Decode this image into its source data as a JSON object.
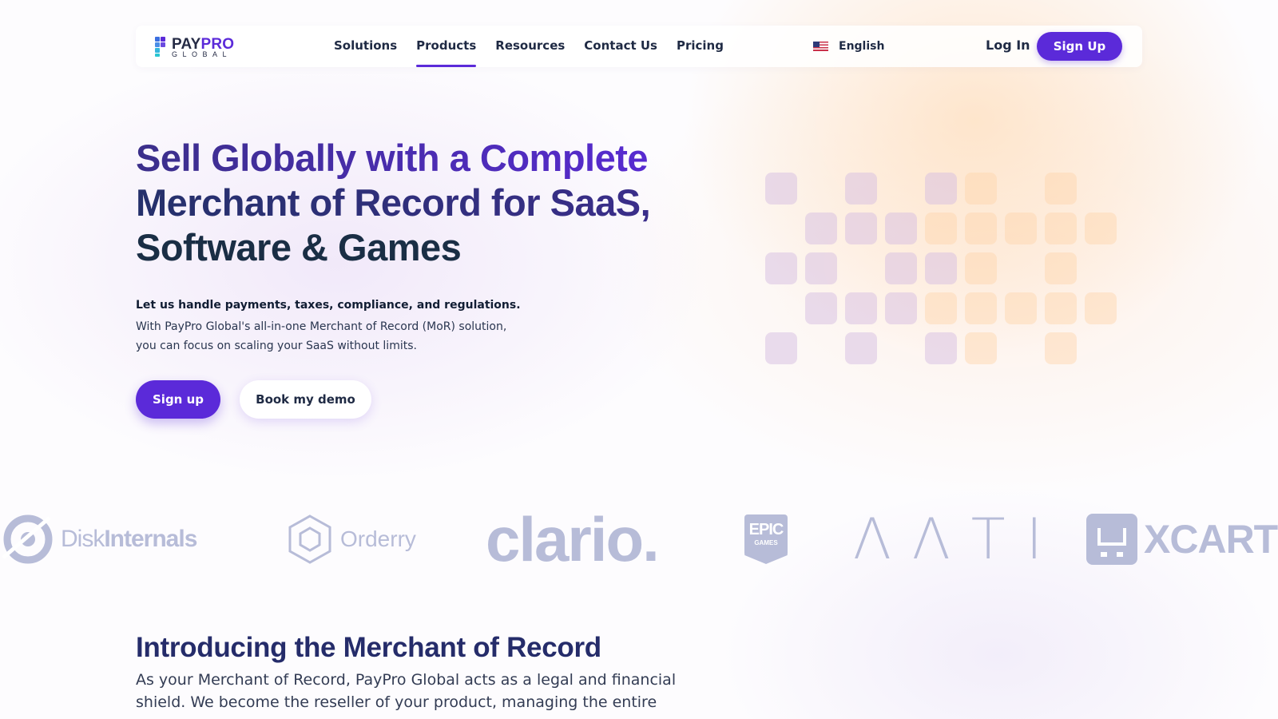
{
  "nav": {
    "logo_main_1": "PAY",
    "logo_main_2": "PRO",
    "logo_sub": "GLOBAL",
    "items": [
      {
        "label": "Solutions",
        "active": false
      },
      {
        "label": "Products",
        "active": true
      },
      {
        "label": "Resources",
        "active": false
      },
      {
        "label": "Contact Us",
        "active": false
      },
      {
        "label": "Pricing",
        "active": false
      }
    ],
    "language": "English",
    "login": "Log In",
    "signup": "Sign Up"
  },
  "hero": {
    "title_lines": [
      "Sell Globally with a Complete",
      "Merchant of Record for SaaS,",
      "Software & Games"
    ],
    "lead": "Let us handle payments, taxes, compliance, and regulations.",
    "body_lines": [
      "With PayPro Global's all-in-one Merchant of Record (MoR) solution,",
      "you can focus on scaling your SaaS without limits."
    ],
    "primary_cta": "Sign up",
    "secondary_cta": "Book my demo"
  },
  "logos": {
    "brands": [
      {
        "name": "DiskInternals",
        "part1": "Disk",
        "part2": "Internals"
      },
      {
        "name": "Orderry",
        "text": "Orderry"
      },
      {
        "name": "clario",
        "text": "clario."
      },
      {
        "name": "Epic Games",
        "line1": "EPIC",
        "line2": "GAMES"
      },
      {
        "name": "AATI",
        "text": "ΛΛΤΙ"
      },
      {
        "name": "XCART",
        "text": "XCART"
      }
    ],
    "color": "#b7bcd8"
  },
  "intro": {
    "title": "Introducing the Merchant of Record",
    "body_lines": [
      "As your Merchant of Record, PayPro Global acts as a legal and financial",
      "shield. We become the reseller of your product, managing the entire"
    ]
  },
  "colors": {
    "accent": "#5b2ad9",
    "text_dark": "#1f2a44"
  }
}
